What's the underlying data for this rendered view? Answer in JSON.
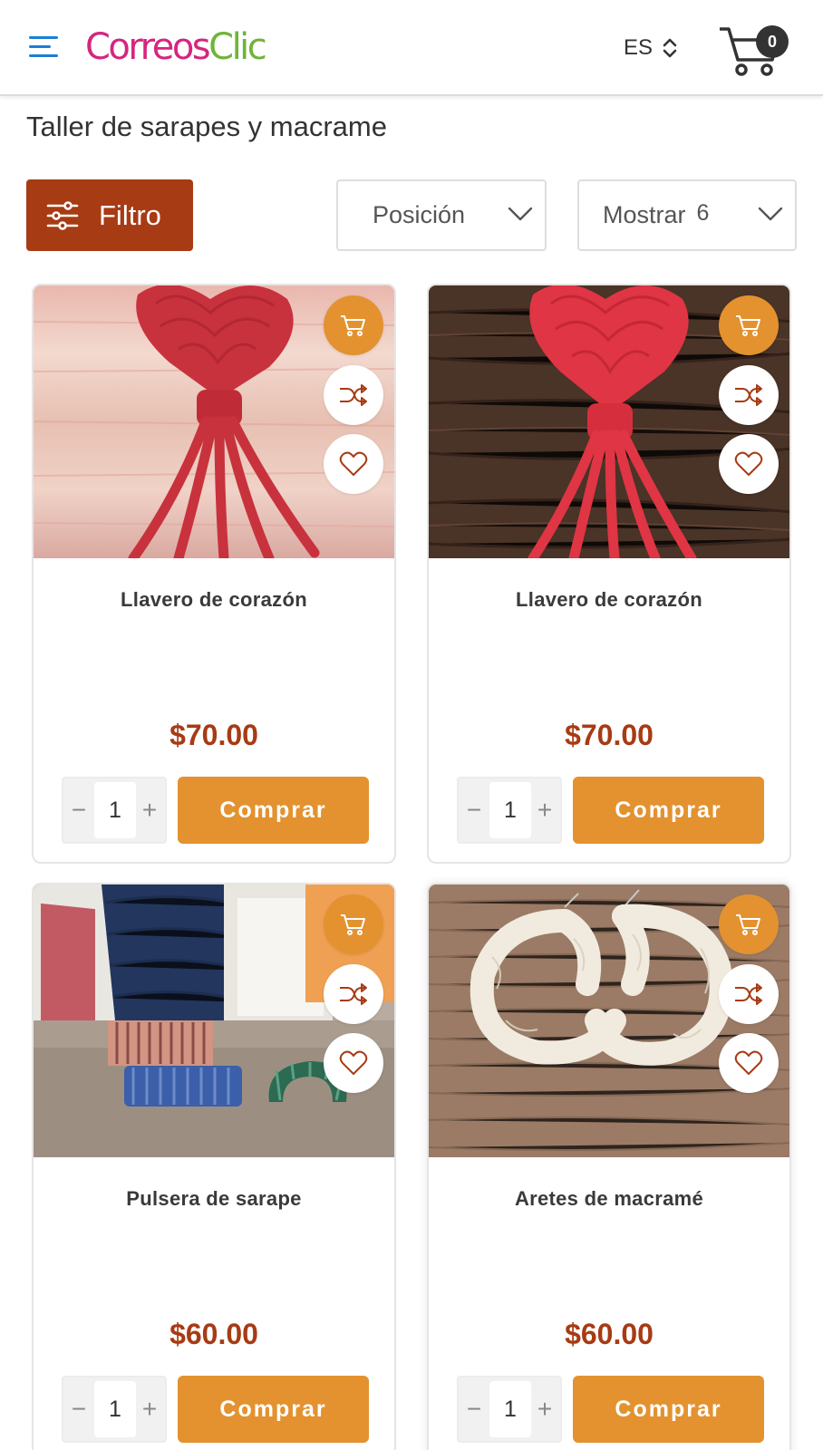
{
  "header": {
    "logo_part1": "Correos",
    "logo_part2": "Clic",
    "language": "ES",
    "cart_count": "0"
  },
  "page": {
    "title": "Taller de sarapes y macrame"
  },
  "toolbar": {
    "filter_label": "Filtro",
    "sort_label": "Posición",
    "show_label": "Mostrar",
    "show_value": "6"
  },
  "products": [
    {
      "name": "Llavero de corazón",
      "price": "$70.00",
      "quantity": "1",
      "buy_label": "Comprar"
    },
    {
      "name": "Llavero de corazón",
      "price": "$70.00",
      "quantity": "1",
      "buy_label": "Comprar"
    },
    {
      "name": "Pulsera de sarape",
      "price": "$60.00",
      "quantity": "1",
      "buy_label": "Comprar"
    },
    {
      "name": "Aretes de macramé",
      "price": "$60.00",
      "quantity": "1",
      "buy_label": "Comprar"
    }
  ],
  "qty_controls": {
    "minus": "−",
    "plus": "+"
  },
  "colors": {
    "brand_pink": "#d6257f",
    "brand_green": "#6fb43a",
    "filter_bg": "#a73b14",
    "accent_orange": "#e3922f",
    "price": "#a73b14"
  }
}
